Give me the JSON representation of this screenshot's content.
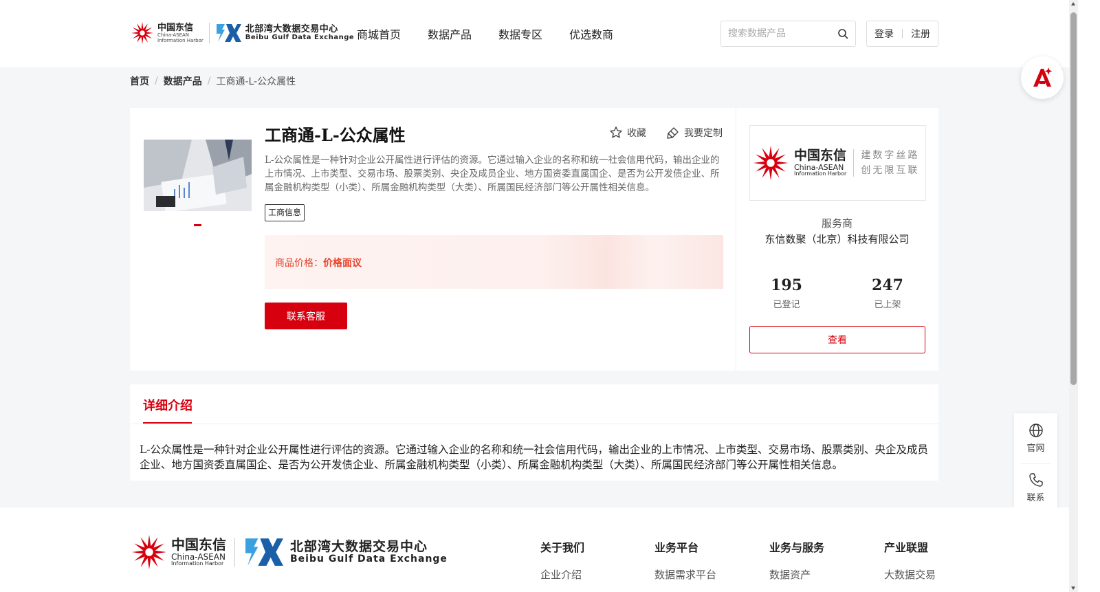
{
  "header": {
    "logo_cn_title": "中国东信",
    "logo_cn_sub1": "China-ASEAN",
    "logo_cn_sub2": "Information Harbor",
    "logo_bx_title": "北部湾大数据交易中心",
    "logo_bx_sub": "Beibu Gulf Data Exchange",
    "nav": [
      "商城首页",
      "数据产品",
      "数据专区",
      "优选数商"
    ],
    "search_placeholder": "搜索数据产品",
    "login": "登录",
    "register": "注册"
  },
  "breadcrumb": [
    "首页",
    "数据产品",
    "工商通-L-公众属性"
  ],
  "product": {
    "title": "工商通-L-公众属性",
    "favorite": "收藏",
    "customize": "我要定制",
    "description": "L-公众属性是一种针对企业公开属性进行评估的资源。它通过输入企业的名称和统一社会信用代码，输出企业的上市情况、上市类型、交易市场、股票类别、央企及成员企业、地方国资委直属国企、是否为公开发债企业、所属金融机构类型（小类）、所属金融机构类型（大类）、所属国民经济部门等公开属性相关信息。",
    "tag": "工商信息",
    "price_label": "商品价格：",
    "price_value": "价格面议",
    "contact_button": "联系客服"
  },
  "provider": {
    "logo_title": "中国东信",
    "logo_sub1": "China-ASEAN",
    "logo_sub2": "Information Harbor",
    "slogan_line1": "建数字丝路",
    "slogan_line2": "创无限互联",
    "label": "服务商",
    "name": "东信数聚（北京）科技有限公司",
    "stats": [
      {
        "value": "195",
        "label": "已登记"
      },
      {
        "value": "247",
        "label": "已上架"
      }
    ],
    "view_button": "查看"
  },
  "detail": {
    "tab": "详细介绍",
    "text": "L-公众属性是一种针对企业公开属性进行评估的资源。它通过输入企业的名称和统一社会信用代码，输出企业的上市情况、上市类型、交易市场、股票类别、央企及成员企业、地方国资委直属国企、是否为公开发债企业、所属金融机构类型（小类）、所属金融机构类型（大类）、所属国民经济部门等公开属性相关信息。"
  },
  "side_float": {
    "website": "官网",
    "contact": "联系"
  },
  "footer": {
    "columns": [
      {
        "title": "关于我们",
        "first_link": "企业介绍"
      },
      {
        "title": "业务平台",
        "first_link": "数据需求平台"
      },
      {
        "title": "业务与服务",
        "first_link": "数据资产"
      },
      {
        "title": "产业联盟",
        "first_link": "大数据交易"
      }
    ]
  },
  "colors": {
    "brand_red": "#d7000f",
    "price_red": "#e6422c",
    "logo_blue": "#1a7fd0"
  },
  "icons": [
    "search-icon",
    "star-icon",
    "customize-icon",
    "globe-icon",
    "phone-icon",
    "ai-assistant-icon"
  ]
}
